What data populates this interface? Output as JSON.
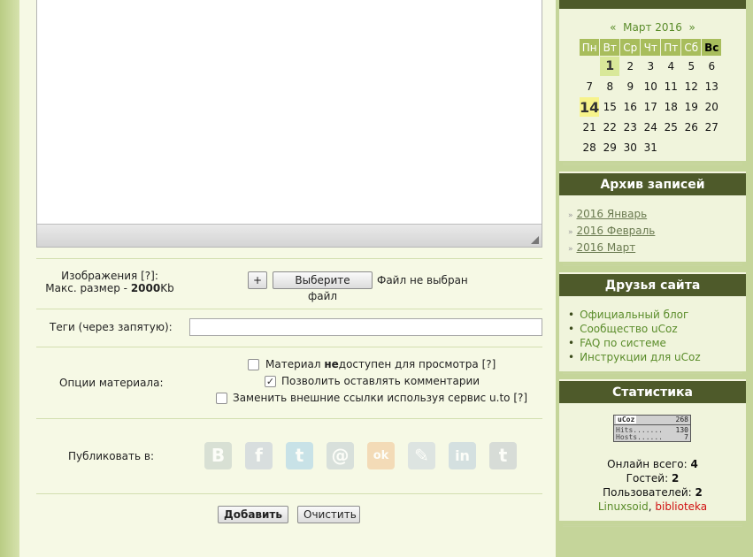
{
  "form": {
    "images_label": "Изображения [?]:",
    "max_size_prefix": "Макс. размер - ",
    "max_size_value": "2000",
    "max_size_unit": "Kb",
    "plus_label": "+",
    "choose_file_label": "Выберите файл",
    "no_file_label": "Файл не выбран",
    "tags_label": "Теги (через запятую):",
    "tags_value": "",
    "options_label": "Опции материала:",
    "option1_pre": "Материал ",
    "option1_bold": "не",
    "option1_post": "доступен для просмотра [?]",
    "option2": "Позволить оставлять комментарии",
    "option3": "Заменить внешние ссылки используя сервис u.to [?]",
    "publish_label": "Публиковать в:",
    "social": [
      {
        "name": "vk",
        "glyph": "B"
      },
      {
        "name": "facebook",
        "glyph": "f"
      },
      {
        "name": "twitter",
        "glyph": "t"
      },
      {
        "name": "mail",
        "glyph": "@"
      },
      {
        "name": "odnoklassniki",
        "glyph": "ok"
      },
      {
        "name": "livejournal",
        "glyph": "✎"
      },
      {
        "name": "linkedin",
        "glyph": "in"
      },
      {
        "name": "tumblr",
        "glyph": "t"
      }
    ],
    "add_label": "Добавить",
    "clear_label": "Очистить"
  },
  "calendar": {
    "prev": "«",
    "month": "Март 2016",
    "next": "»",
    "weekdays": [
      "Пн",
      "Вт",
      "Ср",
      "Чт",
      "Пт",
      "Сб",
      "Вс"
    ],
    "weeks": [
      [
        "",
        "1",
        "2",
        "3",
        "4",
        "5",
        "6"
      ],
      [
        "7",
        "8",
        "9",
        "10",
        "11",
        "12",
        "13"
      ],
      [
        "14",
        "15",
        "16",
        "17",
        "18",
        "19",
        "20"
      ],
      [
        "21",
        "22",
        "23",
        "24",
        "25",
        "26",
        "27"
      ],
      [
        "28",
        "29",
        "30",
        "31",
        "",
        "",
        ""
      ]
    ]
  },
  "archive": {
    "title": "Архив записей",
    "items": [
      "2016 Январь",
      "2016 Февраль",
      "2016 Март"
    ]
  },
  "friends": {
    "title": "Друзья сайта",
    "items": [
      "Официальный блог",
      "Сообщество uCoz",
      "FAQ по системе",
      "Инструкции для uCoz"
    ]
  },
  "stats": {
    "title": "Статистика",
    "counter_logo": "uCoz",
    "counter_top": "268",
    "counter_hits_label": "Hits.......",
    "counter_hits": "130",
    "counter_hosts_label": "Hosts......",
    "counter_hosts": "7",
    "online_label": "Онлайн всего: ",
    "online_value": "4",
    "guests_label": "Гостей: ",
    "guests_value": "2",
    "users_label": "Пользователей: ",
    "users_value": "2",
    "user1": "Linuxsoid",
    "user_sep": ", ",
    "user2": "biblioteka"
  }
}
